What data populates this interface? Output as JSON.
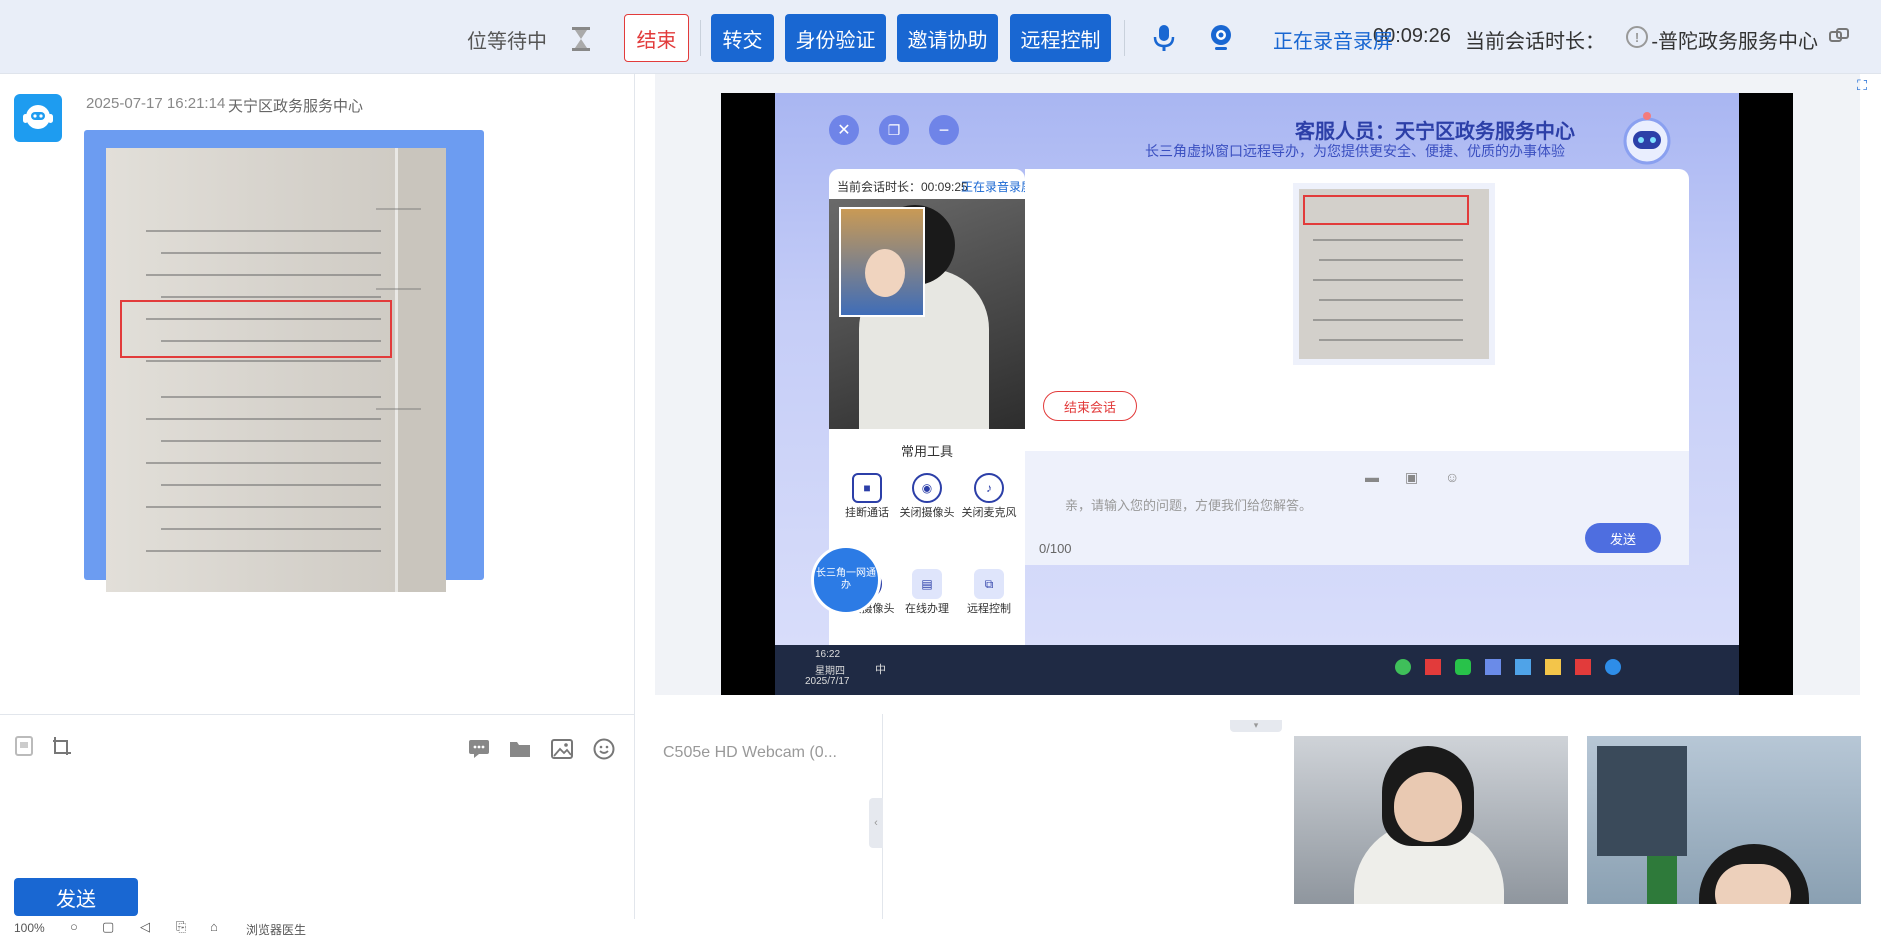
{
  "topbar": {
    "center_name": "普陀政务服务中心-",
    "session_label": "当前会话时长：",
    "session_time": "00:09:26",
    "recording": "正在录音录屏",
    "btn_remote": "远程控制",
    "btn_invite": "邀请协助",
    "btn_verify": "身份验证",
    "btn_transfer": "转交",
    "btn_end": "结束",
    "queue": "位等待中"
  },
  "chat": {
    "sender": "天宁区政务服务中心",
    "timestamp": "2025-07-17 16:21:14"
  },
  "input": {
    "send_label": "发送",
    "webcam": "C505e HD Webcam (0..."
  },
  "remote": {
    "title": "客服人员：天宁区政务服务中心",
    "subtitle": "长三角虚拟窗口远程导办，为您提供更安全、便捷、优质的办事体验",
    "session": "当前会话时长：00:09:25",
    "recording": "正在录音录屏",
    "tools_title": "常用工具",
    "tools": [
      "关闭麦克风",
      "关闭摄像头",
      "挂断通话",
      "远程控制",
      "在线办理",
      "切换摄像头"
    ],
    "end_session": "结束会话",
    "placeholder": "亲，请输入您的问题，方便我们给您解答。",
    "count": "0/100",
    "send": "发送",
    "badge": "长三角一网通办",
    "taskbar_time": "16:22",
    "taskbar_day": "星期四",
    "taskbar_date": "2025/7/17",
    "taskbar_lang": "中"
  },
  "statusbar": {
    "zoom": "100%",
    "browser": "浏览器医生"
  },
  "colors": {
    "accent": "#1967d2",
    "danger": "#e23b3b",
    "topbar_bg": "#e9eef8"
  }
}
